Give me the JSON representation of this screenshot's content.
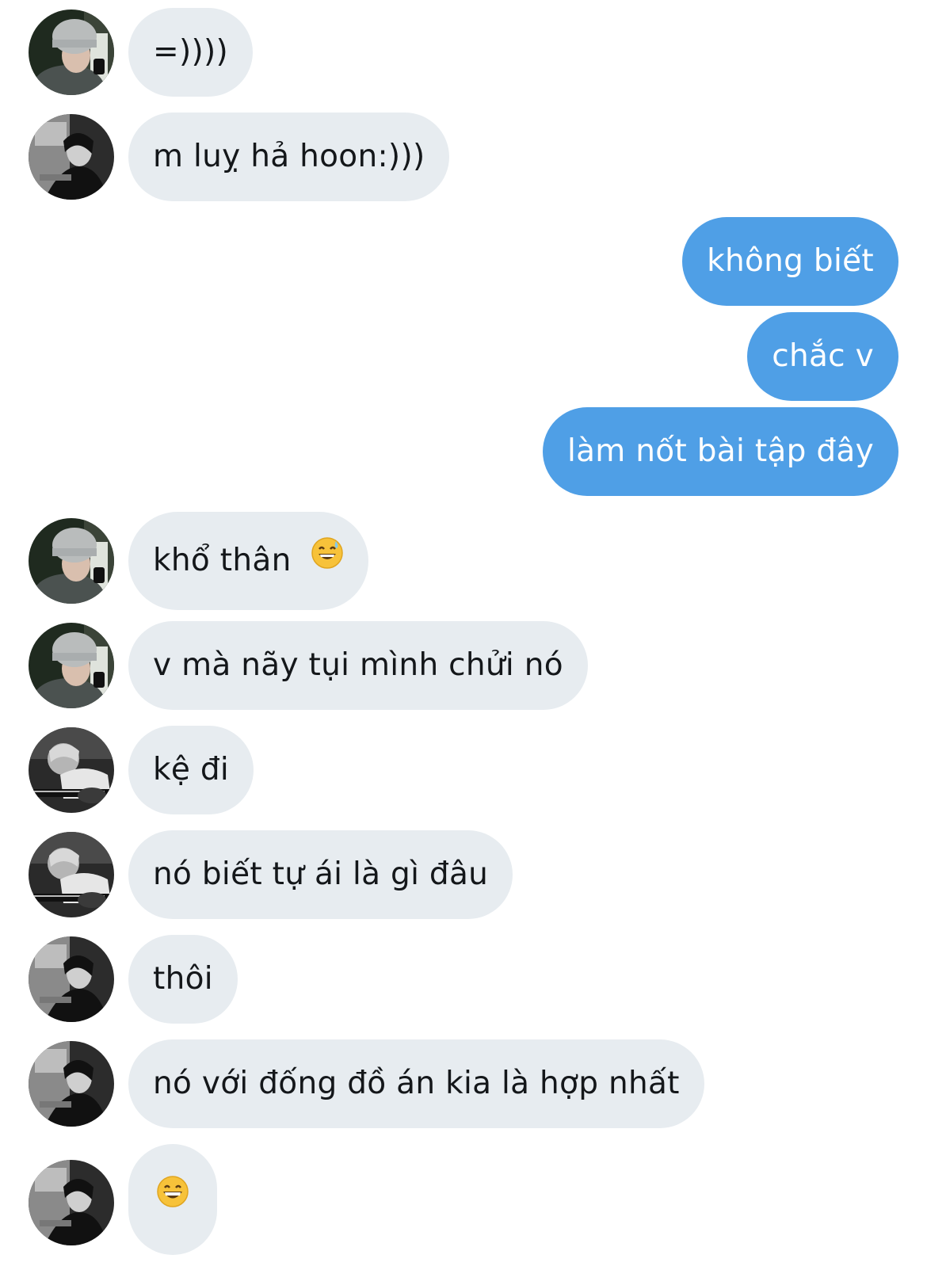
{
  "conversation": {
    "messages": [
      {
        "side": "in",
        "avatar": "beanie",
        "text": "=))))"
      },
      {
        "side": "in",
        "avatar": "dark",
        "text": "m luỵ hả hoon:)))"
      },
      {
        "side": "out",
        "text": "không biết"
      },
      {
        "side": "out",
        "text": "chắc v"
      },
      {
        "side": "out",
        "text": "làm nốt bài tập đây"
      },
      {
        "side": "in",
        "avatar": "beanie",
        "text": "khổ thân",
        "emoji": "grinning-sweat-emoji"
      },
      {
        "side": "in",
        "avatar": "beanie",
        "text": "v mà nãy tụi mình chửi nó"
      },
      {
        "side": "in",
        "avatar": "guitar",
        "text": "kệ đi"
      },
      {
        "side": "in",
        "avatar": "guitar",
        "text": "nó biết tự ái là gì đâu"
      },
      {
        "side": "in",
        "avatar": "dark",
        "text": "thôi"
      },
      {
        "side": "in",
        "avatar": "dark",
        "text": "nó với đống đồ án kia là hợp nhất"
      },
      {
        "side": "in",
        "avatar": "dark",
        "text": "",
        "emoji": "grinning-emoji"
      }
    ]
  },
  "colors": {
    "incoming_bubble": "#e7ecf0",
    "outgoing_bubble": "#4f9fe6",
    "incoming_text": "#14171a",
    "outgoing_text": "#ffffff"
  }
}
